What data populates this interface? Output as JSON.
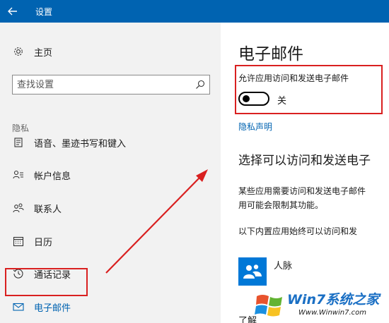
{
  "window": {
    "title": "设置"
  },
  "sidebar": {
    "home_label": "主页",
    "search_placeholder": "查找设置",
    "section_header": "隐私",
    "items": [
      {
        "label": "语音、墨迹书写和键入",
        "icon": "pen-icon"
      },
      {
        "label": "帐户信息",
        "icon": "account-info-icon"
      },
      {
        "label": "联系人",
        "icon": "contacts-icon"
      },
      {
        "label": "日历",
        "icon": "calendar-icon"
      },
      {
        "label": "通话记录",
        "icon": "call-history-icon"
      },
      {
        "label": "电子邮件",
        "icon": "mail-icon",
        "selected": true
      }
    ]
  },
  "content": {
    "title": "电子邮件",
    "setting_label": "允许应用访问和发送电子邮件",
    "toggle_state": "关",
    "toggle_on": false,
    "privacy_link": "隐私声明",
    "section_title": "选择可以访问和发送电子",
    "desc_line1": "某些应用需要访问和发送电子邮件",
    "desc_line2": "用可能会限制其功能。",
    "list_caption": "以下内置应用始终可以访问和发",
    "app_name": "人脉",
    "cut_text": "了解"
  },
  "watermark": {
    "main": "Win7系统之家",
    "sub": "Www.Winwin7.com"
  },
  "colors": {
    "accent": "#0063b1",
    "sidebar_bg": "#f2f2f2",
    "highlight": "#d92020"
  }
}
